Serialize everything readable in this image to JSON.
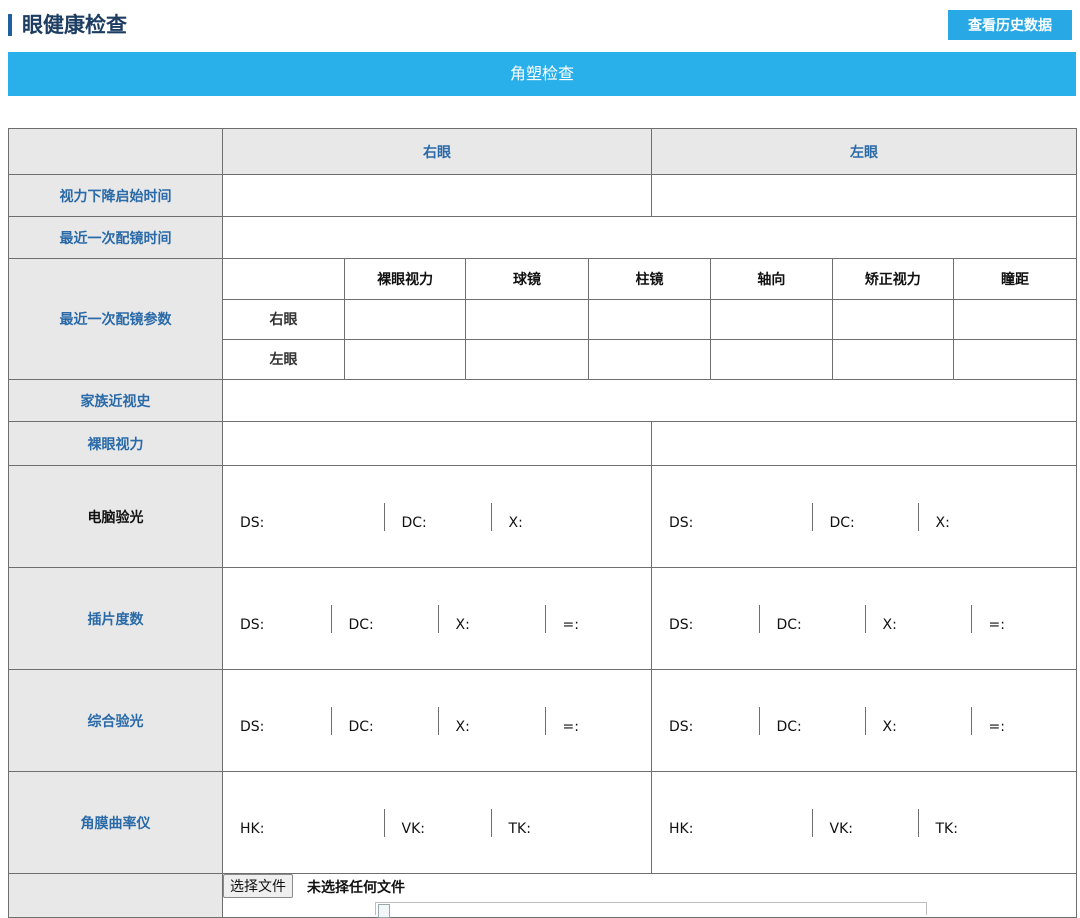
{
  "header": {
    "title": "眼健康检查",
    "history_button": "查看历史数据"
  },
  "section": {
    "title": "角塑检查"
  },
  "table": {
    "col_headers": {
      "right_eye": "右眼",
      "left_eye": "左眼"
    },
    "rows": {
      "vision_decline_start": "视力下降启始时间",
      "last_glasses_time": "最近一次配镜时间",
      "last_glasses_params": "最近一次配镜参数",
      "family_myopia": "家族近视史",
      "naked_vision": "裸眼视力",
      "computer_refraction": "电脑验光",
      "trial_lens": "插片度数",
      "comprehensive_refraction": "综合验光",
      "keratometer": "角膜曲率仪"
    },
    "params": {
      "headers": [
        "裸眼视力",
        "球镜",
        "柱镜",
        "轴向",
        "矫正视力",
        "瞳距"
      ],
      "right_label": "右眼",
      "left_label": "左眼"
    },
    "computer_refraction_fields": [
      "DS:",
      "DC:",
      "X:",
      "DS:",
      "DC:",
      "X:"
    ],
    "trial_lens_fields": [
      "DS:",
      "DC:",
      "X:",
      "=:",
      "DS:",
      "DC:",
      "X:",
      "=:"
    ],
    "comprehensive_fields": [
      "DS:",
      "DC:",
      "X:",
      "=:",
      "DS:",
      "DC:",
      "X:",
      "=:"
    ],
    "keratometer_fields": [
      "HK:",
      "VK:",
      "TK:",
      "HK:",
      "VK:",
      "TK:"
    ],
    "file": {
      "button": "选择文件",
      "status": "未选择任何文件"
    }
  }
}
